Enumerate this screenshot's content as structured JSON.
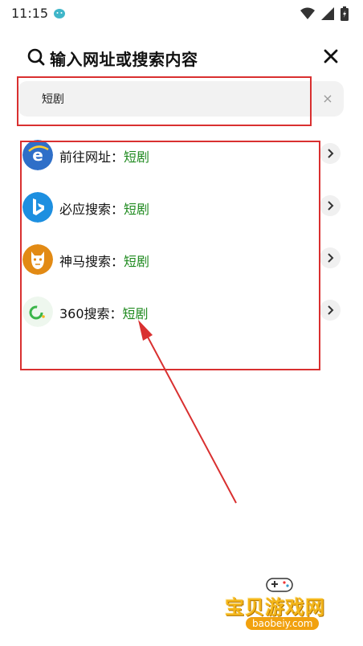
{
  "status_bar": {
    "time": "11:15",
    "app_icon": "baby-face-icon",
    "wifi_icon": "wifi-icon",
    "signal_icon": "signal-icon",
    "battery_icon": "battery-icon"
  },
  "header": {
    "title": "输入网址或搜索内容",
    "search_icon": "search-icon",
    "close_icon": "close-icon"
  },
  "search": {
    "value": "短剧",
    "clear_label": "×"
  },
  "suggestions": [
    {
      "prefix": "前往网址：",
      "keyword": "短剧",
      "icon": "ie-browser-icon",
      "icon_color": "#2f6fc8"
    },
    {
      "prefix": "必应搜索：",
      "keyword": "短剧",
      "icon": "bing-icon",
      "icon_color": "#1d8fe0"
    },
    {
      "prefix": "神马搜索：",
      "keyword": "短剧",
      "icon": "shenma-icon",
      "icon_color": "#e28a14"
    },
    {
      "prefix": "360搜索：",
      "keyword": "短剧",
      "icon": "360-search-icon",
      "icon_color": "#3bb54a"
    }
  ],
  "annotation_color": "#d93030",
  "keyword_color": "#1f8a1f",
  "watermark": {
    "text": "宝贝游戏网",
    "url": "baobeiy.com"
  }
}
